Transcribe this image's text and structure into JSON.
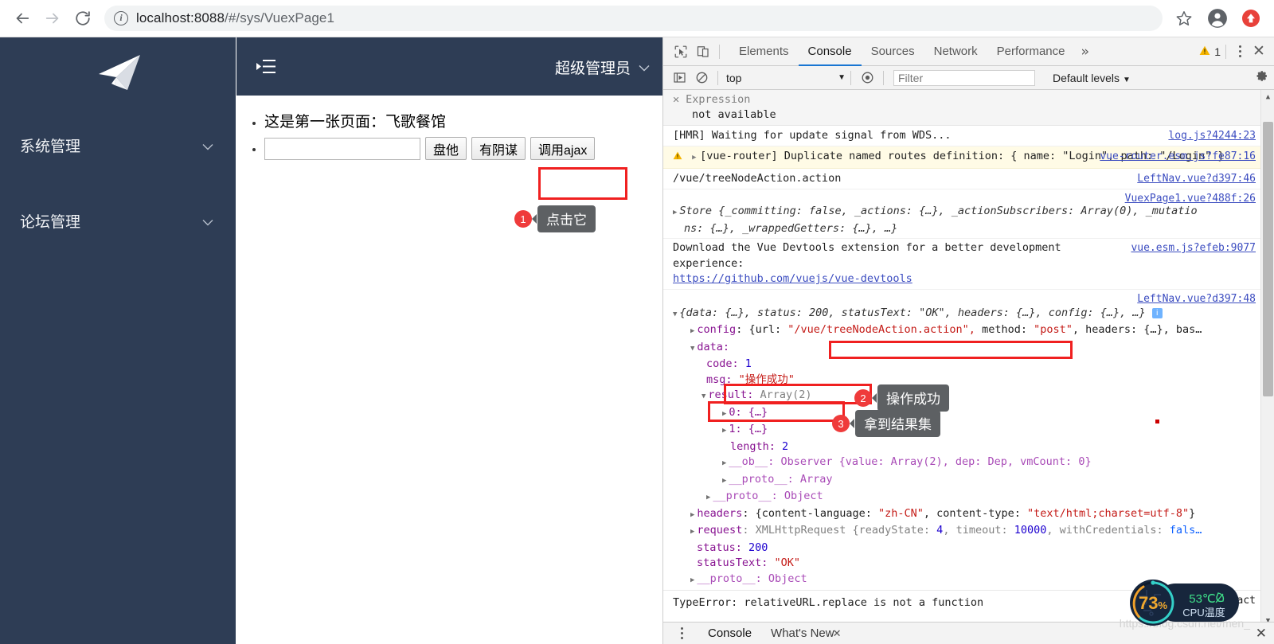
{
  "browser": {
    "url_prefix": "localhost:8088",
    "url_path": "/#/sys/VuexPage1",
    "back_icon": "arrow-left-icon",
    "forward_icon": "arrow-right-icon",
    "reload_icon": "reload-icon",
    "info_icon": "info-icon",
    "star_icon": "star-icon",
    "profile_icon": "profile-avatar-icon",
    "update_icon": "update-available-icon"
  },
  "app": {
    "sidebar": {
      "logo": "paper-plane-logo",
      "items": [
        {
          "label": "系统管理",
          "chevron": "chevron-down-icon"
        },
        {
          "label": "论坛管理",
          "chevron": "chevron-down-icon"
        }
      ]
    },
    "header": {
      "collapse_icon": "collapse-menu-icon",
      "user_name": "超级管理员",
      "user_chevron": "chevron-down-icon"
    },
    "content": {
      "line1": "这是第一张页面：飞歌餐馆",
      "input_value": "",
      "input_placeholder": "",
      "buttons": [
        {
          "label": "盘他"
        },
        {
          "label": "有阴谋"
        },
        {
          "label": "调用ajax"
        }
      ]
    },
    "callout1": {
      "num": "1",
      "text": "点击它"
    }
  },
  "devtools": {
    "toolbar": {
      "inspect_icon": "inspect-element-icon",
      "device_icon": "device-toolbar-icon",
      "tabs": [
        {
          "label": "Elements",
          "active": false
        },
        {
          "label": "Console",
          "active": true
        },
        {
          "label": "Sources",
          "active": false
        },
        {
          "label": "Network",
          "active": false
        },
        {
          "label": "Performance",
          "active": false
        }
      ],
      "more_tabs": "»",
      "warning_icon": "warning-triangle-icon",
      "warning_count": "1",
      "kebab_icon": "more-options-icon",
      "close_icon": "close-icon"
    },
    "filterbar": {
      "execute_icon": "execute-sidebar-icon",
      "clear_icon": "clear-console-icon",
      "context": "top",
      "context_chevron": "▼",
      "eye_icon": "live-expression-icon",
      "filter_placeholder": "Filter",
      "filter_value": "",
      "levels": "Default levels",
      "levels_chevron": "▼",
      "settings_icon": "gear-icon"
    },
    "sidebar_expr": {
      "close_icon": "close-icon",
      "label": "Expression",
      "value": "not available"
    },
    "messages": [
      {
        "text": "[HMR] Waiting for update signal from WDS...",
        "source": "log.js?4244:23",
        "type": "log"
      },
      {
        "text": "[vue-router] Duplicate named routes definition: { name: \"Login\", path: \"/Login\" }",
        "source": "vue-router.esm.js?fe87:16",
        "type": "warning"
      },
      {
        "text": "/vue/treeNodeAction.action",
        "source": "LeftNav.vue?d397:46",
        "type": "log"
      }
    ],
    "store_entry": {
      "source": "VuexPage1.vue?488f:26",
      "line1": "Store {_committing: false, _actions: {…}, _actionSubscribers: Array(0), _mutatio",
      "line2": "ns: {…}, _wrappedGetters: {…}, …}"
    },
    "devtools_notice": {
      "text": "Download the Vue Devtools extension for a better development experience:",
      "source": "vue.esm.js?efeb:9077",
      "link": "https://github.com/vuejs/vue-devtools"
    },
    "response_object": {
      "source": "LeftNav.vue?d397:48",
      "summary": "{data: {…}, status: 200, statusText: \"OK\", headers: {…}, config: {…}, …}",
      "config_line": "config: {url: \"/vue/treeNodeAction.action\", method: \"post\", headers: {…}, bas…",
      "config_url": "\"/vue/treeNodeAction.action\",",
      "data_label": "data:",
      "code_key": "code:",
      "code_value": "1",
      "msg_key": "msg:",
      "msg_value": "\"操作成功\"",
      "result_key": "result:",
      "result_value": "Array(2)",
      "item0": "0: {…}",
      "item1": "1: {…}",
      "length_key": "length:",
      "length_value": "2",
      "ob_line": "__ob__: Observer {value: Array(2), dep: Dep, vmCount: 0}",
      "proto_array": "__proto__: Array",
      "proto_object": "__proto__: Object",
      "headers_line": "headers: {content-language: \"zh-CN\", content-type: \"text/html;charset=utf-8\"}",
      "request_line": "request: XMLHttpRequest {readyState: 4, timeout: 10000, withCredentials: fals…",
      "status_key": "status:",
      "status_value": "200",
      "statustext_key": "statusText:",
      "statustext_value": "\"OK\"",
      "proto_object2": "__proto__: Object"
    },
    "error_line": {
      "text": "TypeError: relativeURL.replace is not a function",
      "source": "act"
    },
    "callout2": {
      "num": "2",
      "text": "操作成功"
    },
    "callout3": {
      "num": "3",
      "text": "拿到结果集"
    },
    "drawer": {
      "kebab_icon": "more-options-icon",
      "tabs": [
        {
          "label": "Console",
          "active": true
        },
        {
          "label": "What's New",
          "active": false
        }
      ],
      "tab_close_icon": "close-icon",
      "close_icon": "close-drawer-icon"
    },
    "scrollbar": {
      "up_icon": "scroll-up-arrow",
      "down_icon": "scroll-down-arrow"
    }
  },
  "overlay": {
    "cpu_percent": "73",
    "cpu_percent_unit": "%",
    "temp": "53℃",
    "temp_icon": "leaf-icon",
    "temp_label": "CPU温度",
    "watermark": "https://blog.csdn.net/men_"
  },
  "colors": {
    "sidebar_bg": "#2e3d55",
    "accent_red": "#f02020",
    "tab_active": "#1976d2",
    "warn_bg": "#fffbe6",
    "callout_badge": "#ef3b3b",
    "callout_tip": "#5d6063"
  }
}
